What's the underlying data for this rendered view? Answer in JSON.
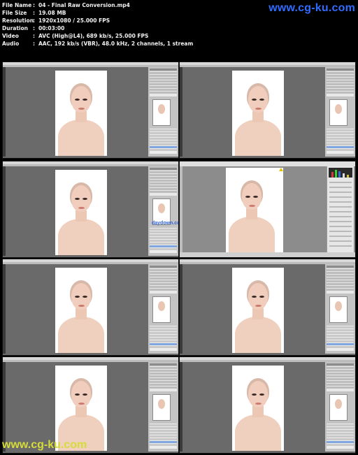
{
  "header": {
    "rows": [
      {
        "key": "File Name",
        "value": "04 - Final Raw Conversion.mp4"
      },
      {
        "key": "File Size",
        "value": "19.08 MB"
      },
      {
        "key": "Resolution",
        "value": "1920x1080 / 25.000 FPS"
      },
      {
        "key": "Duration",
        "value": "00:03:00"
      },
      {
        "key": "Video",
        "value": "AVC (High@L4), 689 kb/s, 25.000 FPS"
      },
      {
        "key": "Audio",
        "value": "AAC, 192 kb/s (VBR), 48.0 kHz, 2 channels, 1 stream"
      }
    ],
    "separator": ":",
    "watermark": "www.cg-ku.com"
  },
  "footer": {
    "watermark": "www.cg-ku.com"
  },
  "frames": [
    {
      "label": "frame-1",
      "kind": "photoshop"
    },
    {
      "label": "frame-2",
      "kind": "photoshop"
    },
    {
      "label": "frame-3",
      "kind": "photoshop",
      "overlay": "daydown.com"
    },
    {
      "label": "frame-4",
      "kind": "camera-raw"
    },
    {
      "label": "frame-5",
      "kind": "photoshop"
    },
    {
      "label": "frame-6",
      "kind": "photoshop"
    },
    {
      "label": "frame-7",
      "kind": "photoshop"
    },
    {
      "label": "frame-8",
      "kind": "photoshop"
    }
  ],
  "colors": {
    "watermark_top": "#2f6cff",
    "watermark_bottom": "#d6dc38",
    "workspace_gray": "#6a6a6a",
    "selected_layer": "#7fa6de"
  }
}
